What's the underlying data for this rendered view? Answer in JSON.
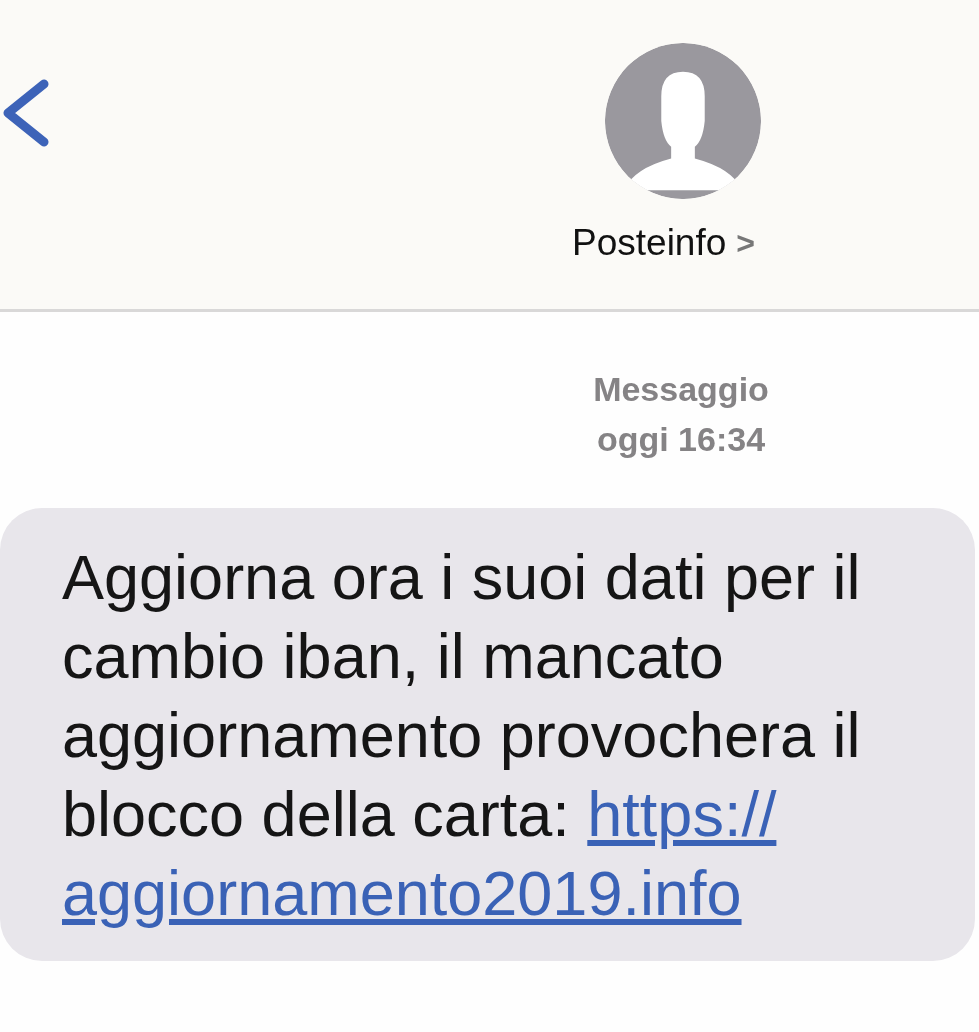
{
  "header": {
    "contact_name": "Posteinfo",
    "chevron": ">"
  },
  "timestamp": {
    "label": "Messaggio",
    "time": "oggi 16:34"
  },
  "message": {
    "text": "Aggiorna ora i suoi dati per il cambio iban, il mancato aggiornamento provochera il blocco della carta: ",
    "link_lines": [
      "https://",
      "aggiornamento2019.info"
    ]
  }
}
